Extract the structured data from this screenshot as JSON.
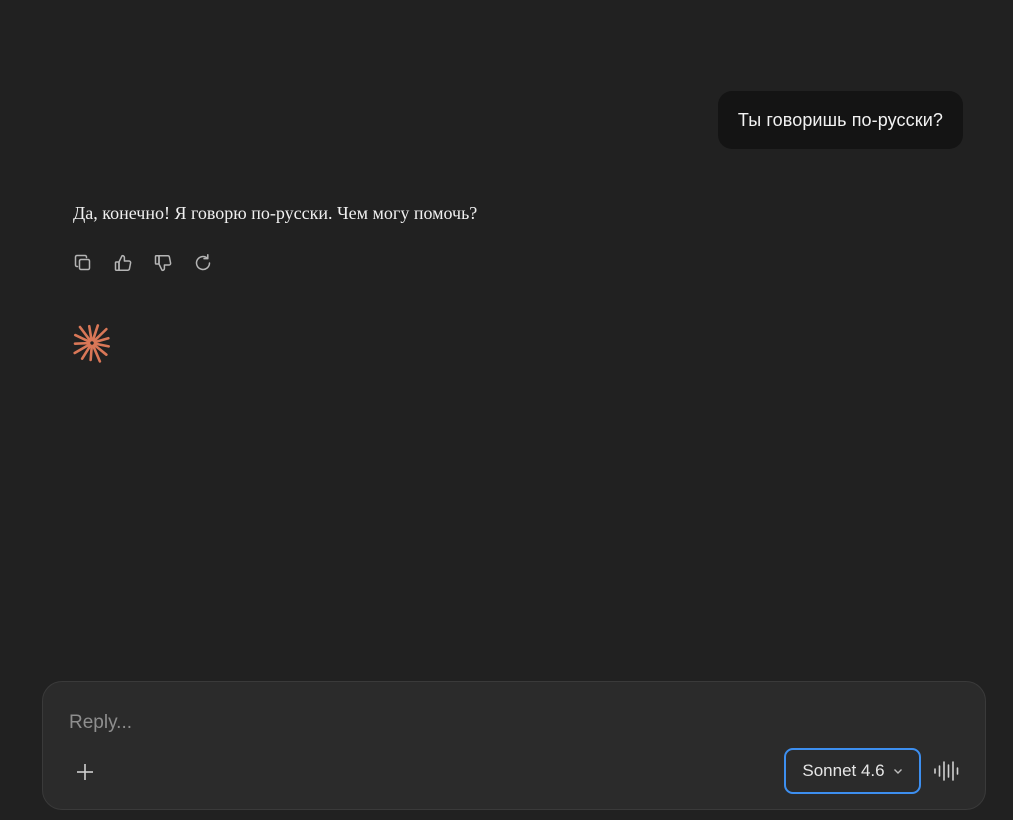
{
  "conversation": {
    "user_message": "Ты говоришь по-русски?",
    "assistant_message": "Да, конечно! Я говорю по-русски. Чем могу помочь?",
    "actions": [
      {
        "name": "copy-icon"
      },
      {
        "name": "thumbs-up-icon"
      },
      {
        "name": "thumbs-down-icon"
      },
      {
        "name": "retry-icon"
      }
    ],
    "loading_indicator": {
      "icon": "claude-spark-icon",
      "color": "#d97757"
    }
  },
  "composer": {
    "placeholder": "Reply...",
    "value": "",
    "add_icon": "plus-icon",
    "model_label": "Sonnet 4.6",
    "model_icon": "chevron-down-icon",
    "voice_icon": "voice-waveform-icon",
    "accent_color": "#3d8ff0"
  }
}
